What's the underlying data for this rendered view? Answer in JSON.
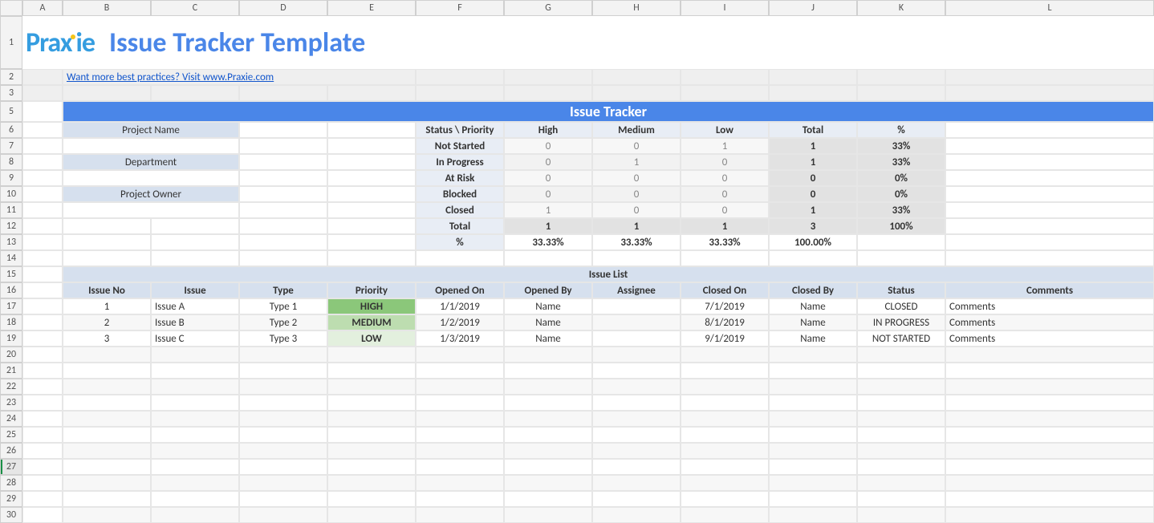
{
  "columns": [
    "A",
    "B",
    "C",
    "D",
    "E",
    "F",
    "G",
    "H",
    "I",
    "J",
    "K",
    "L"
  ],
  "rows": [
    "1",
    "2",
    "3",
    "5",
    "6",
    "7",
    "8",
    "9",
    "10",
    "11",
    "12",
    "13",
    "14",
    "15",
    "16",
    "17",
    "18",
    "19",
    "20",
    "21",
    "22",
    "23",
    "24",
    "25",
    "26",
    "27",
    "28",
    "29",
    "30"
  ],
  "logo": "Praxie",
  "title": "Issue Tracker Template",
  "link": "Want more best practices? Visit www.Praxie.com",
  "header": "Issue Tracker",
  "meta": {
    "project_name": "Project Name",
    "department": "Department",
    "project_owner": "Project Owner"
  },
  "summary": {
    "corner": "Status \\ Priority",
    "cols": [
      "High",
      "Medium",
      "Low",
      "Total",
      "%"
    ],
    "rows": [
      {
        "label": "Not Started",
        "cells": [
          "0",
          "0",
          "1"
        ],
        "total": "1",
        "pct": "33%"
      },
      {
        "label": "In Progress",
        "cells": [
          "0",
          "1",
          "0"
        ],
        "total": "1",
        "pct": "33%"
      },
      {
        "label": "At Risk",
        "cells": [
          "0",
          "0",
          "0"
        ],
        "total": "0",
        "pct": "0%"
      },
      {
        "label": "Blocked",
        "cells": [
          "0",
          "0",
          "0"
        ],
        "total": "0",
        "pct": "0%"
      },
      {
        "label": "Closed",
        "cells": [
          "1",
          "0",
          "0"
        ],
        "total": "1",
        "pct": "33%"
      }
    ],
    "total_row": {
      "label": "Total",
      "cells": [
        "1",
        "1",
        "1"
      ],
      "total": "3",
      "pct": "100%"
    },
    "pct_row": {
      "label": "%",
      "cells": [
        "33.33%",
        "33.33%",
        "33.33%"
      ],
      "total": "100.00%",
      "pct": ""
    }
  },
  "issue_list": {
    "title": "Issue List",
    "headers": [
      "Issue No",
      "Issue",
      "Type",
      "Priority",
      "Opened On",
      "Opened By",
      "Assignee",
      "Closed On",
      "Closed By",
      "Status",
      "Comments"
    ],
    "rows": [
      {
        "no": "1",
        "issue": "Issue A",
        "type": "Type 1",
        "priority": "HIGH",
        "opened": "1/1/2019",
        "opened_by": "Name",
        "assignee": "",
        "closed": "7/1/2019",
        "closed_by": "Name",
        "status": "CLOSED",
        "comments": "Comments"
      },
      {
        "no": "2",
        "issue": "Issue B",
        "type": "Type 2",
        "priority": "MEDIUM",
        "opened": "1/2/2019",
        "opened_by": "Name",
        "assignee": "",
        "closed": "8/1/2019",
        "closed_by": "Name",
        "status": "IN PROGRESS",
        "comments": "Comments"
      },
      {
        "no": "3",
        "issue": "Issue C",
        "type": "Type 3",
        "priority": "LOW",
        "opened": "1/3/2019",
        "opened_by": "Name",
        "assignee": "",
        "closed": "9/1/2019",
        "closed_by": "Name",
        "status": "NOT STARTED",
        "comments": "Comments"
      }
    ]
  },
  "selected_row": "27"
}
